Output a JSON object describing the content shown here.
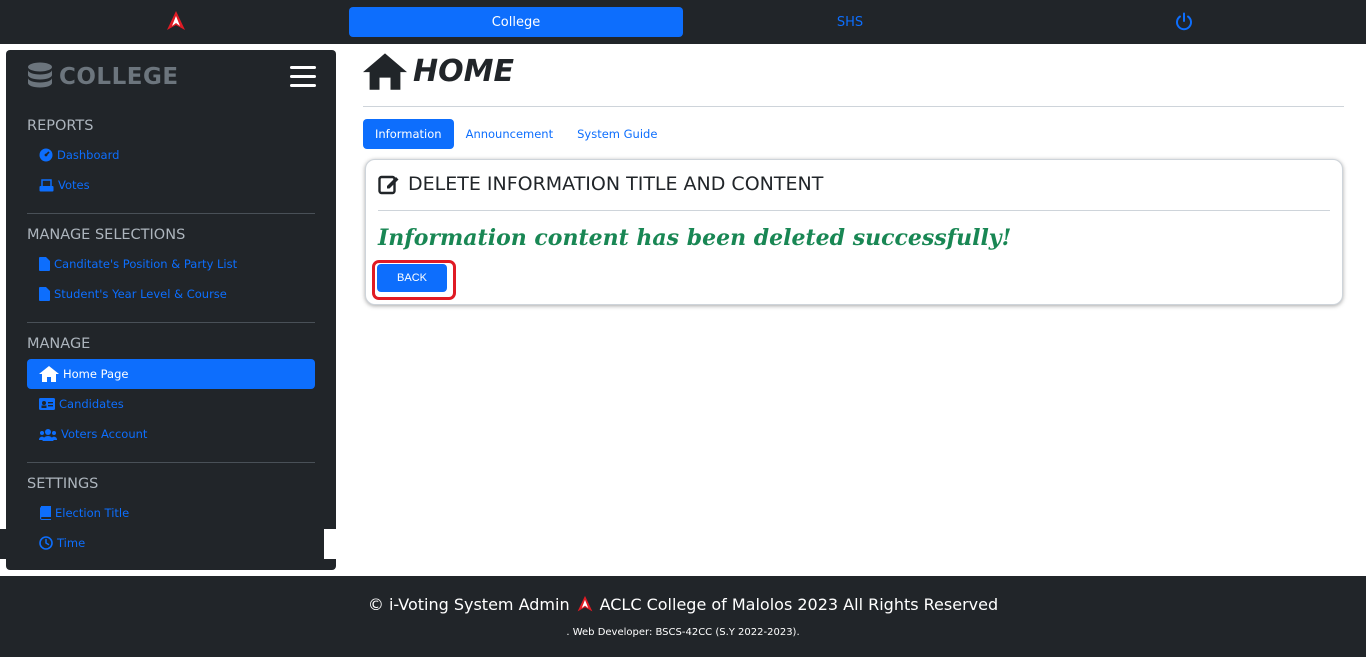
{
  "topbar": {
    "tab_college": "College",
    "tab_shs": "SHS"
  },
  "sidebar": {
    "brand": "COLLEGE",
    "sections": {
      "reports": "REPORTS",
      "manage_selections": "MANAGE SELECTIONS",
      "manage": "MANAGE",
      "settings": "SETTINGS"
    },
    "items": {
      "dashboard": "Dashboard",
      "votes": "Votes",
      "positions": "Canditate's Position & Party List",
      "year_level": "Student's Year Level & Course",
      "home_page": "Home Page",
      "candidates": "Candidates",
      "voters_account": "Voters Account",
      "election_title": "Election Title",
      "time": "Time"
    }
  },
  "main": {
    "title": "HOME",
    "tabs": {
      "information": "Information",
      "announcement": "Announcement",
      "system_guide": "System Guide"
    },
    "card": {
      "title": "DELETE INFORMATION TITLE AND CONTENT",
      "message": "Information content has been deleted successfully!",
      "back_label": "BACK"
    }
  },
  "footer": {
    "main_left": "© i-Voting System Admin",
    "main_right": "ACLC College of Malolos 2023 All Rights Reserved",
    "sub": ". Web Developer: BSCS-42CC (S.Y 2022-2023)."
  },
  "colors": {
    "primary": "#0d6efd",
    "dark": "#212529",
    "success": "#198754",
    "highlight": "#e01b24"
  }
}
